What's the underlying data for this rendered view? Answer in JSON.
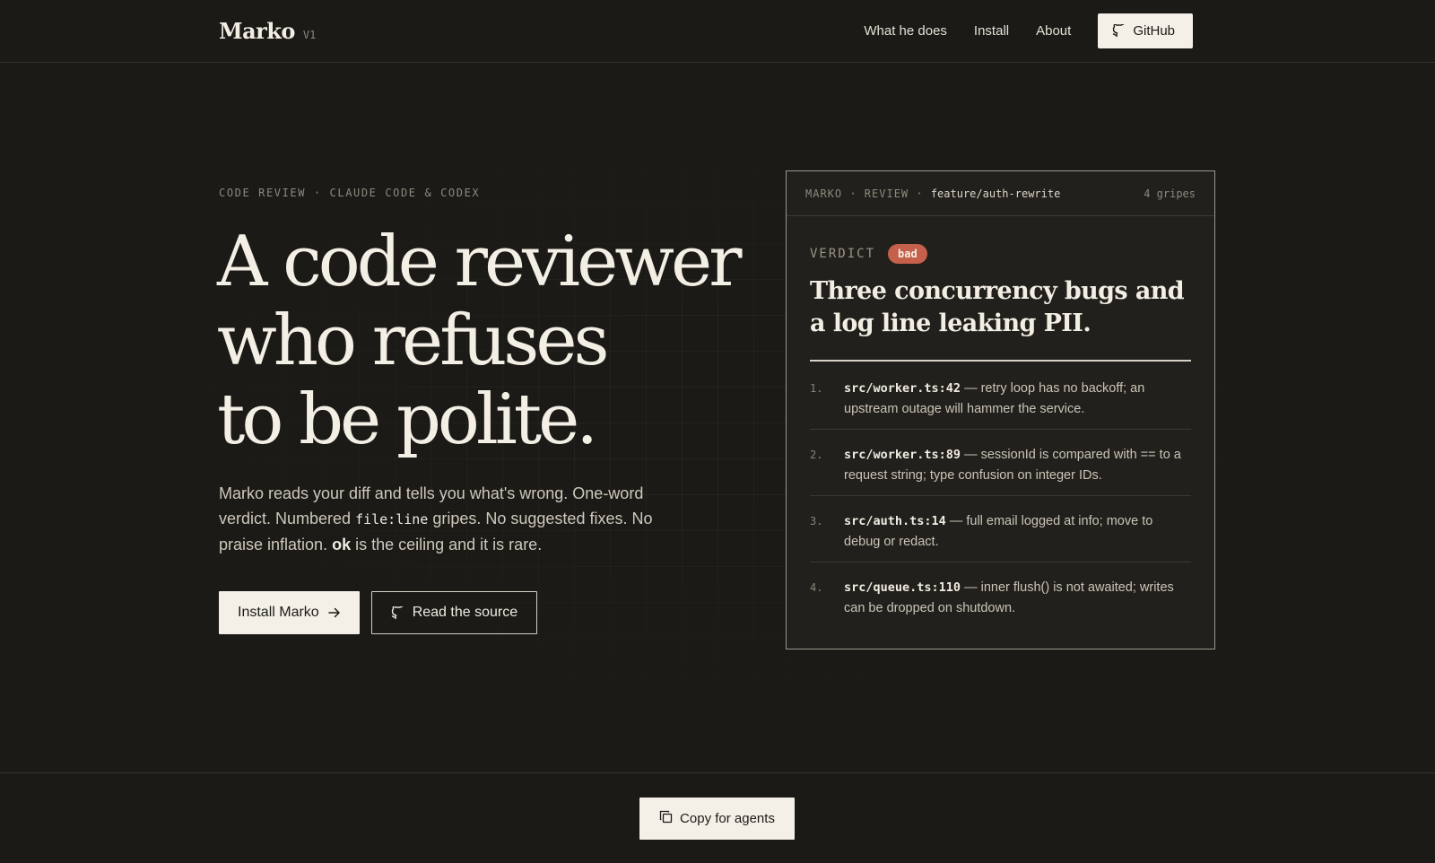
{
  "brand": {
    "name": "Marko",
    "version": "V1"
  },
  "nav": {
    "links": [
      "What he does",
      "Install",
      "About"
    ],
    "github_label": "GitHub"
  },
  "hero": {
    "eyebrow": "CODE REVIEW · CLAUDE CODE & CODEX",
    "headline": [
      "A code reviewer",
      "who refuses",
      "to be polite."
    ],
    "lede": {
      "part1": "Marko reads your diff and tells you what's wrong. One-word verdict. Numbered ",
      "code": "file:line",
      "part2": " gripes. No suggested fixes. No praise inflation. ",
      "strong": "ok",
      "part3": " is the ceiling and it is rare."
    },
    "primary_cta": "Install Marko",
    "secondary_cta": "Read the source"
  },
  "review_card": {
    "header_left": "MARKO · REVIEW · ",
    "branch": "feature/auth-rewrite",
    "count": "4 gripes",
    "verdict_label": "VERDICT",
    "verdict": "bad",
    "summary": "Three concurrency bugs and a log line leaking PII.",
    "gripes": [
      {
        "num": "1.",
        "loc": "src/worker.ts:42",
        "text": " — retry loop has no backoff; an upstream outage will hammer the service."
      },
      {
        "num": "2.",
        "loc": "src/worker.ts:89",
        "text": " — sessionId is compared with == to a request string; type confusion on integer IDs."
      },
      {
        "num": "3.",
        "loc": "src/auth.ts:14",
        "text": " — full email logged at info; move to debug or redact."
      },
      {
        "num": "4.",
        "loc": "src/queue.ts:110",
        "text": " — inner flush() is not awaited; writes can be dropped on shutdown."
      }
    ]
  },
  "footer": {
    "copy_label": "Copy for agents"
  },
  "colors": {
    "background": "#1b1a17",
    "accent_bad": "#c4604b",
    "button_light": "#f4f0e8"
  },
  "icons": {
    "github": "github-icon",
    "arrow": "arrow-right-icon",
    "copy": "copy-icon"
  }
}
